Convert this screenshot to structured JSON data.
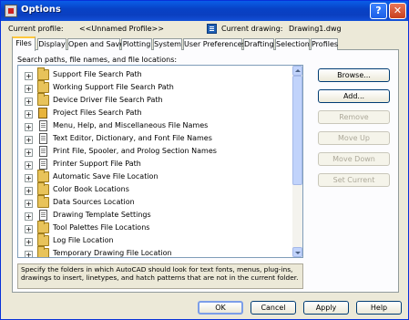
{
  "window": {
    "title": "Options",
    "help_glyph": "?",
    "close_glyph": "✕"
  },
  "profile": {
    "current_profile_label": "Current profile:",
    "current_profile_value": "<<Unnamed Profile>>",
    "current_drawing_label": "Current drawing:",
    "current_drawing_value": "Drawing1.dwg"
  },
  "tabs": [
    {
      "label": "Files",
      "active": true
    },
    {
      "label": "Display"
    },
    {
      "label": "Open and Save"
    },
    {
      "label": "Plotting"
    },
    {
      "label": "System"
    },
    {
      "label": "User Preferences"
    },
    {
      "label": "Drafting"
    },
    {
      "label": "Selection"
    },
    {
      "label": "Profiles"
    }
  ],
  "files_tab": {
    "list_label": "Search paths, file names, and file locations:",
    "items": [
      {
        "label": "Support File Search Path",
        "icon": "folder-icon"
      },
      {
        "label": "Working Support File Search Path",
        "icon": "folder-icon"
      },
      {
        "label": "Device Driver File Search Path",
        "icon": "folder-icon"
      },
      {
        "label": "Project Files Search Path",
        "icon": "book-icon"
      },
      {
        "label": "Menu, Help, and Miscellaneous File Names",
        "icon": "document-icon"
      },
      {
        "label": "Text Editor, Dictionary, and Font File Names",
        "icon": "document-icon"
      },
      {
        "label": "Print File, Spooler, and Prolog Section Names",
        "icon": "document-icon"
      },
      {
        "label": "Printer Support File Path",
        "icon": "document-icon"
      },
      {
        "label": "Automatic Save File Location",
        "icon": "folder-icon"
      },
      {
        "label": "Color Book Locations",
        "icon": "folder-icon"
      },
      {
        "label": "Data Sources Location",
        "icon": "folder-icon"
      },
      {
        "label": "Drawing Template Settings",
        "icon": "document-icon"
      },
      {
        "label": "Tool Palettes File Locations",
        "icon": "folder-icon"
      },
      {
        "label": "Log File Location",
        "icon": "folder-icon"
      },
      {
        "label": "Temporary Drawing File Location",
        "icon": "folder-icon"
      }
    ],
    "expander_glyph": "+",
    "buttons": {
      "browse": "Browse...",
      "add": "Add...",
      "remove": "Remove",
      "move_up": "Move Up",
      "move_down": "Move Down",
      "set_current": "Set Current"
    },
    "description": "Specify the folders in which AutoCAD should look for text fonts, menus, plug-ins, drawings to insert, linetypes, and hatch patterns that are not in the current folder."
  },
  "footer": {
    "ok": "OK",
    "cancel": "Cancel",
    "apply": "Apply",
    "help": "Help"
  }
}
